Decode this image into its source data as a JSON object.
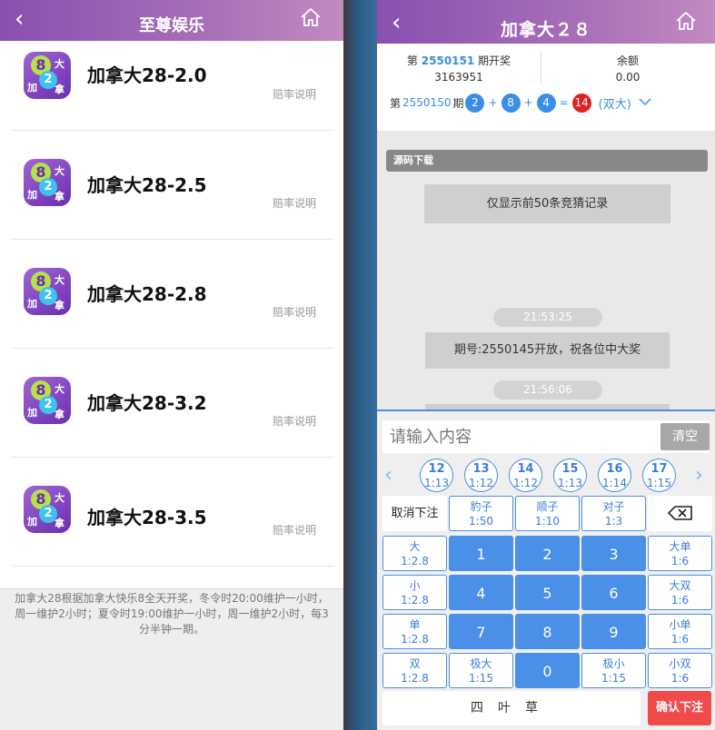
{
  "left": {
    "header": {
      "back_glyph": "‹",
      "title": "至尊娱乐",
      "home_icon": "home-icon"
    },
    "games": [
      {
        "name": "加拿大28-2.0",
        "link": "赔率说明"
      },
      {
        "name": "加拿大28-2.5",
        "link": "赔率说明"
      },
      {
        "name": "加拿大28-2.8",
        "link": "赔率说明"
      },
      {
        "name": "加拿大28-3.2",
        "link": "赔率说明"
      },
      {
        "name": "加拿大28-3.5",
        "link": "赔率说明"
      }
    ],
    "icon_text": {
      "ball8": "8",
      "ball2": "2",
      "ch1": "大",
      "ch2": "加",
      "ch3": "拿"
    },
    "note": {
      "line1": "加拿大28根据加拿大快乐8全天开奖，冬令时20:00维护一小时，",
      "line2": "周一维护2小时；夏令时19:00维护一小时，周一维护2小时，每3",
      "line3": "分半钟一期。"
    }
  },
  "right": {
    "header": {
      "back_glyph": "‹",
      "title": "加拿大２８",
      "home_icon": "home-icon"
    },
    "current": {
      "prefix": "第",
      "issue": "2550151",
      "suffix": "期开奖",
      "countdown": "3163951"
    },
    "balance": {
      "label": "余额",
      "value": "0.00"
    },
    "last_draw": {
      "prefix": "第",
      "issue": "2550150",
      "suffix": "期",
      "balls": [
        "2",
        "8",
        "4"
      ],
      "plus": "+",
      "equals": "=",
      "sum": "14",
      "result": "(双大)"
    },
    "chat": {
      "source_bar": "源码下载",
      "notice": "仅显示前50条竞猜记录",
      "time1": "21:53:25",
      "message1": "期号:2550145开放，祝各位中大奖",
      "time2": "21:56:06"
    },
    "bet": {
      "input_placeholder": "请输入内容",
      "clear": "清空",
      "nav_left": "‹",
      "nav_right": "›",
      "sum_chips": [
        {
          "n": "12",
          "o": "1:13"
        },
        {
          "n": "13",
          "o": "1:12"
        },
        {
          "n": "14",
          "o": "1:12"
        },
        {
          "n": "15",
          "o": "1:13"
        },
        {
          "n": "16",
          "o": "1:14"
        },
        {
          "n": "17",
          "o": "1:15"
        }
      ],
      "cancel": "取消下注",
      "baozi": {
        "l1": "豹子",
        "l2": "1:50"
      },
      "shunzi": {
        "l1": "顺子",
        "l2": "1:10"
      },
      "duizi": {
        "l1": "对子",
        "l2": "1:3"
      },
      "big": {
        "l1": "大",
        "l2": "1:2.8"
      },
      "small": {
        "l1": "小",
        "l2": "1:2.8"
      },
      "odd": {
        "l1": "单",
        "l2": "1:2.8"
      },
      "even": {
        "l1": "双",
        "l2": "1:2.8"
      },
      "big_odd": {
        "l1": "大单",
        "l2": "1:6"
      },
      "big_even": {
        "l1": "大双",
        "l2": "1:6"
      },
      "small_odd": {
        "l1": "小单",
        "l2": "1:6"
      },
      "small_even": {
        "l1": "小双",
        "l2": "1:6"
      },
      "extreme_big": {
        "l1": "极大",
        "l2": "1:15"
      },
      "extreme_small": {
        "l1": "极小",
        "l2": "1:15"
      },
      "digits": [
        "1",
        "2",
        "3",
        "4",
        "5",
        "6",
        "7",
        "8",
        "9",
        "0"
      ],
      "bottom_text": "四叶草",
      "confirm": "确认下注"
    }
  },
  "colors": {
    "header_gradient_start": "#8a4fb0",
    "header_gradient_end": "#c28ac0",
    "accent_blue": "#4a8fe8",
    "sum_red": "#e02020",
    "confirm_red": "#f04a4a"
  }
}
